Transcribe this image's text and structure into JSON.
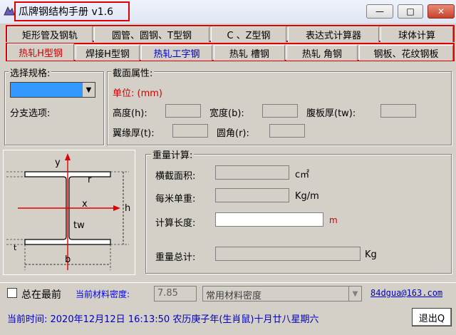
{
  "window": {
    "title": "瓜牌钢结构手册 v1.6",
    "min_glyph": "—",
    "max_glyph": "□",
    "close_glyph": "✕"
  },
  "tabs": {
    "row1": [
      "矩形管及钢轨",
      "圆管、圆钢、T型钢",
      "C 、Z型钢",
      "表达式计算器",
      "球体计算"
    ],
    "row2": [
      "热轧H型钢",
      "焊接H型钢",
      "热轧工字钢",
      "热轧 槽钢",
      "热轧 角钢",
      "钢板、花纹钢板"
    ]
  },
  "spec": {
    "group_label": "选择规格:",
    "branch_label": "分支选项:"
  },
  "section": {
    "group_label": "截面属性:",
    "unit_label": "单位: (mm)",
    "height_label": "高度(h):",
    "width_label": "宽度(b):",
    "web_label": "腹板厚(tw):",
    "flange_label": "翼缘厚(t):",
    "radius_label": "圆角(r):"
  },
  "diagram": {
    "y": "y",
    "x": "x",
    "r": "r",
    "t": "t",
    "tw": "tw",
    "h": "h",
    "b": "b"
  },
  "weight": {
    "group_label": "重量计算:",
    "area_label": "横截面积:",
    "area_unit": "c㎡",
    "unit_weight_label": "每米单重:",
    "unit_weight_unit": "Kg/m",
    "length_label": "计算长度:",
    "length_unit": "m",
    "total_label": "重量总计:",
    "total_unit": "Kg"
  },
  "footer": {
    "top_label": "总在最前",
    "density_label": "当前材料密度:",
    "density_value": "7.85",
    "material_select": "常用材料密度",
    "email": "84dgua@163.com",
    "time_text": "当前时间: 2020年12月12日  16:13:50  农历庚子年(生肖鼠)十月廿八星期六",
    "exit_button": "退出Q"
  },
  "colors": {
    "accent_red": "#e00000",
    "link_blue": "#0000c0",
    "dropdown_blue": "#3399ff"
  }
}
